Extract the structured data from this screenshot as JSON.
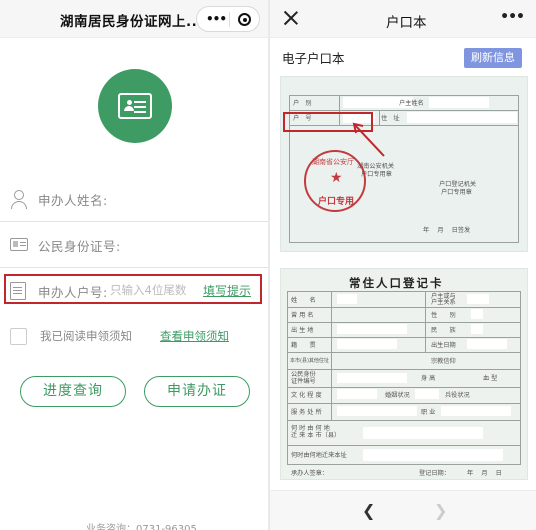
{
  "left": {
    "title": "湖南居民身份证网上...",
    "fields": {
      "name_label": "申办人姓名:",
      "id_label": "公民身份证号:",
      "household_label": "申办人户号:",
      "household_placeholder": "只输入4位尾数",
      "fill_hint": "填写提示"
    },
    "agree_label": "我已阅读申领须知",
    "notice_link": "查看申领须知",
    "progress_button": "进度查询",
    "apply_button": "申请办证",
    "hotline": "业务咨询：0731-96305"
  },
  "right": {
    "title": "户口本",
    "section_label": "电子户口本",
    "refresh_button": "刷新信息",
    "doc1": {
      "household_category": "户　别",
      "head_name": "户主姓名",
      "household_no": "户　号",
      "address": "住　址",
      "office_seal_line1": "户口登记机关",
      "office_seal_line2": "户口专用章",
      "seal_arc": "湖南省公安厅",
      "seal_center": "户口专用",
      "seal_inner_line1": "湖南公安机关",
      "seal_inner_line2": "户口专用章",
      "issue_date": "年　 月　 日签发"
    },
    "doc2": {
      "card_title": "常住人口登记卡",
      "rows": {
        "name": "姓　　名",
        "relation1": "户主或与",
        "relation2": "户主关系",
        "used_name": "曾 用 名",
        "sex": "性　　别",
        "birthplace": "出 生 地",
        "ethnic": "民　　族",
        "native": "籍　　贯",
        "birthdate": "出生日期",
        "other_address": "本市(县)其他住址",
        "religion": "宗教信仰",
        "id_no1": "公民身份",
        "id_no2": "证件编号",
        "height": "身 高",
        "blood": "血 型",
        "education": "文 化 程 度",
        "marital": "婚姻状况",
        "military": "兵役状况",
        "workplace": "服 务 处 所",
        "job": "职 业",
        "move_in1": "何 时 由 何 地",
        "move_in2": "迁 来 本 市（县）",
        "move_in_addr": "何时由何地迁来本址",
        "handler": "承办人签章：",
        "reg_date": "登记日期：",
        "date_ymd": "年　 月　 日"
      }
    }
  },
  "colors": {
    "brand_green": "#3e9b64",
    "highlight_red": "#c0272d",
    "refresh_blue": "#7f95e0"
  }
}
